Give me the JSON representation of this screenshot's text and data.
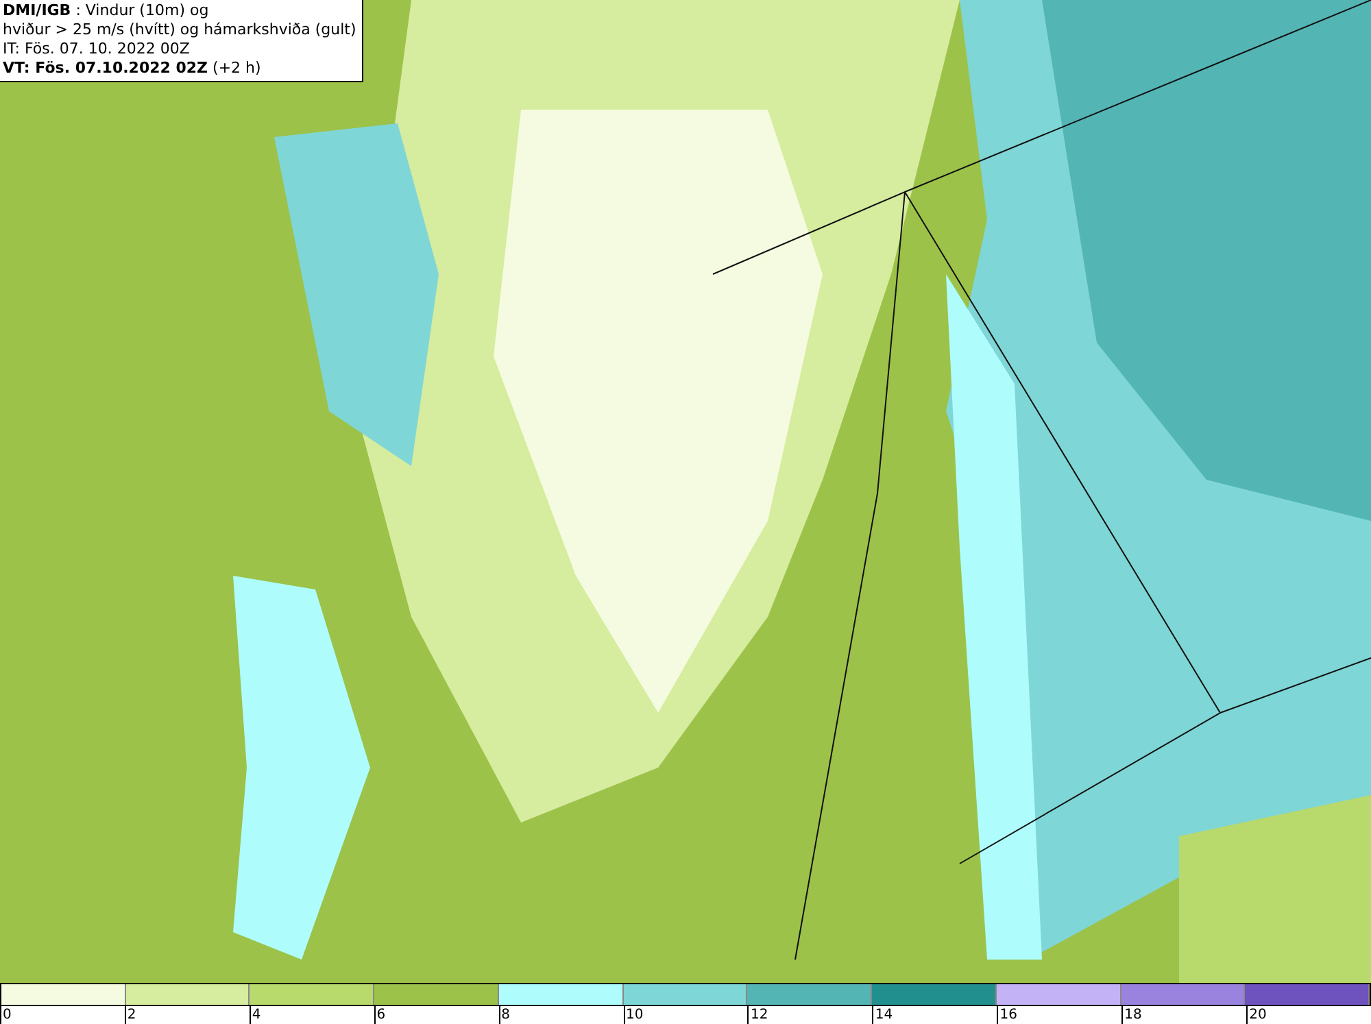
{
  "header": {
    "lines": [
      "**DMI/IGB** : Vindur (10m) og",
      "hviður > 25 m/s (hvítt) og hámarkshviða (gult)",
      "IT: Fös. 07. 10. 2022 00Z",
      "**VT: Fös. 07.10.2022 02Z** (+2 h)"
    ]
  },
  "legend": {
    "segments": [
      {
        "color": "#f5fbe0",
        "tick": "0"
      },
      {
        "color": "#d6ec9e",
        "tick": "2"
      },
      {
        "color": "#b8d96b",
        "tick": "4"
      },
      {
        "color": "#9cc24a",
        "tick": "6"
      },
      {
        "color": "#aefcfc",
        "tick": "8"
      },
      {
        "color": "#7fd6d6",
        "tick": "10"
      },
      {
        "color": "#54b5b5",
        "tick": "12"
      },
      {
        "color": "#228f8f",
        "tick": "14"
      },
      {
        "color": "#c4b2f7",
        "tick": "16"
      },
      {
        "color": "#9a83de",
        "tick": "18"
      },
      {
        "color": "#6e52be",
        "tick": "20"
      }
    ]
  }
}
